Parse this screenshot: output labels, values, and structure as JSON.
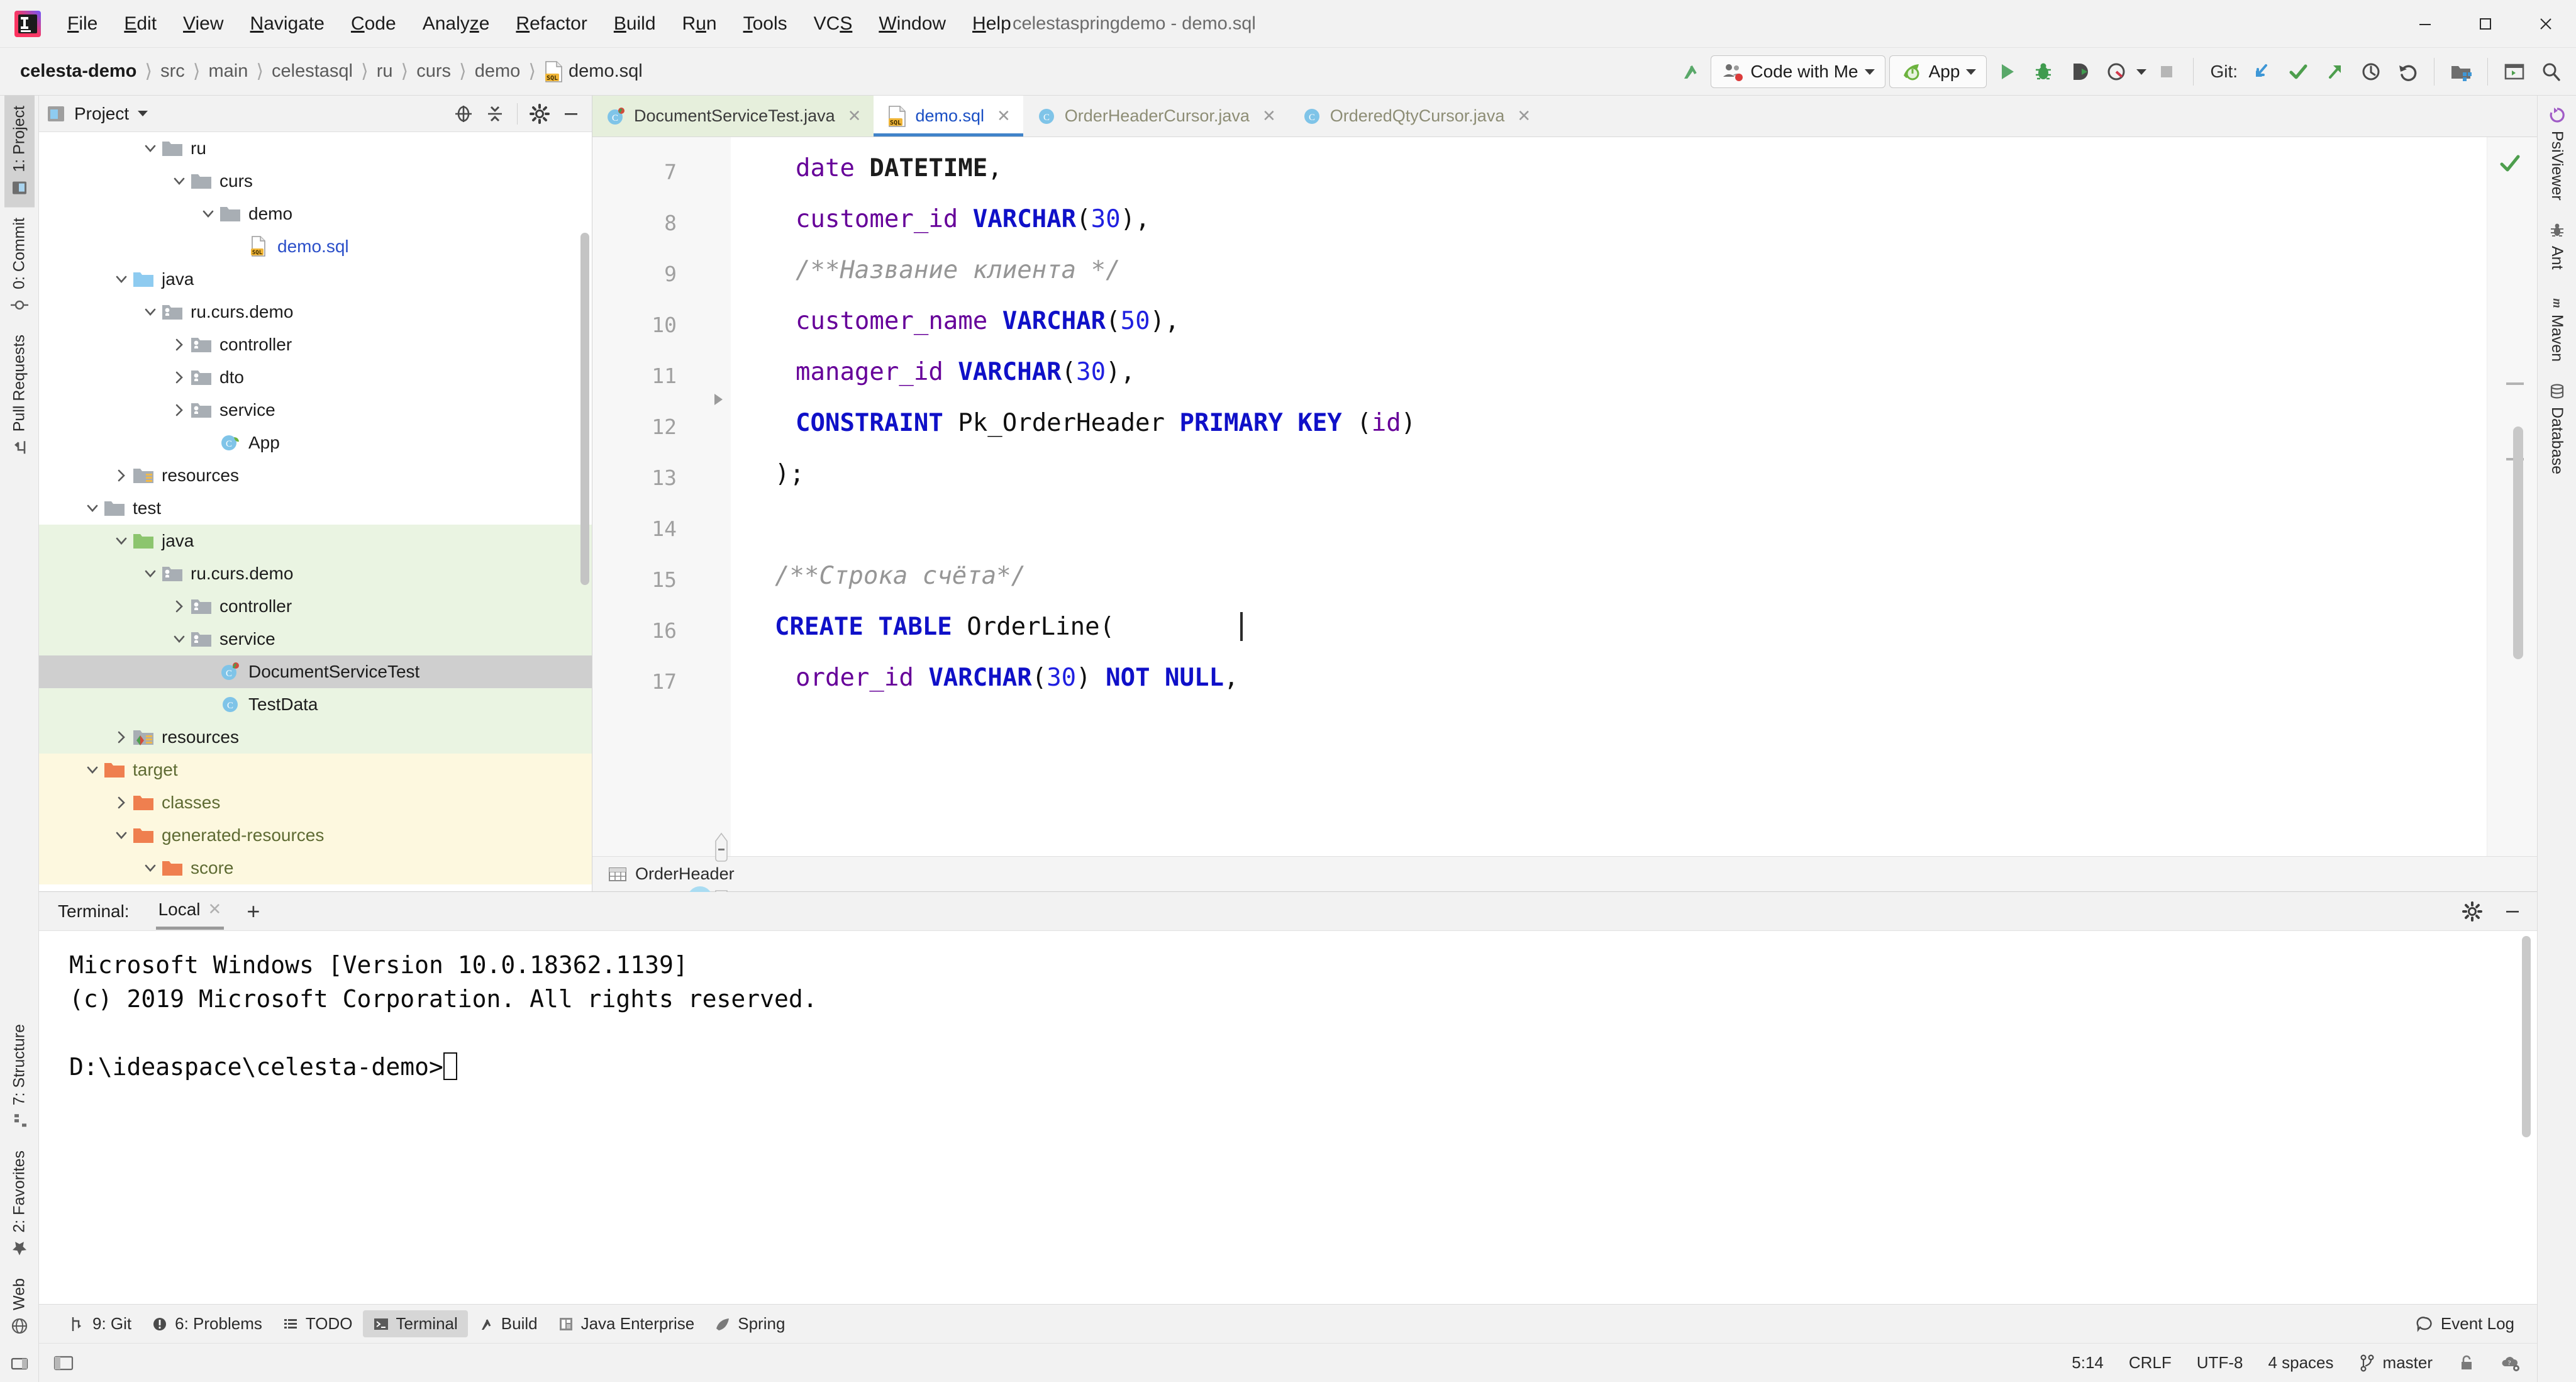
{
  "window": {
    "title": "celestaspringdemo - demo.sql",
    "controls": [
      "minimize",
      "maximize",
      "close"
    ]
  },
  "menubar": {
    "items": [
      {
        "label": "File",
        "mnemonic": "F"
      },
      {
        "label": "Edit",
        "mnemonic": "E"
      },
      {
        "label": "View",
        "mnemonic": "V"
      },
      {
        "label": "Navigate",
        "mnemonic": "N"
      },
      {
        "label": "Code",
        "mnemonic": "C"
      },
      {
        "label": "Analyze",
        "mnemonic": "z"
      },
      {
        "label": "Refactor",
        "mnemonic": "R"
      },
      {
        "label": "Build",
        "mnemonic": "B"
      },
      {
        "label": "Run",
        "mnemonic": "u"
      },
      {
        "label": "Tools",
        "mnemonic": "T"
      },
      {
        "label": "VCS",
        "mnemonic": "S"
      },
      {
        "label": "Window",
        "mnemonic": "W"
      },
      {
        "label": "Help",
        "mnemonic": "H"
      }
    ]
  },
  "breadcrumbs": {
    "items": [
      "celesta-demo",
      "src",
      "main",
      "celestasql",
      "ru",
      "curs",
      "demo",
      "demo.sql"
    ]
  },
  "toolbar": {
    "code_with_me": "Code with Me",
    "run_config": "App",
    "git_label": "Git:",
    "icons": [
      "build-icon",
      "code-with-me-icon",
      "run-config-icon",
      "run-icon",
      "debug-icon",
      "run-with-coverage-icon",
      "profile-icon",
      "stop-icon",
      "git-update-icon",
      "git-commit-icon",
      "git-push-icon",
      "git-history-icon",
      "git-rollback-icon",
      "project-structure-icon",
      "terminal-window-icon",
      "search-everywhere-icon"
    ]
  },
  "left_tool_strip": {
    "top": [
      {
        "label": "1: Project",
        "icon": "project-icon",
        "active": true
      },
      {
        "label": "0: Commit",
        "icon": "commit-icon",
        "active": false
      },
      {
        "label": "Pull Requests",
        "icon": "pull-request-icon",
        "active": false
      }
    ],
    "bottom": [
      {
        "label": "7: Structure",
        "icon": "structure-icon"
      },
      {
        "label": "2: Favorites",
        "icon": "star-icon"
      },
      {
        "label": "Web",
        "icon": "web-icon"
      }
    ]
  },
  "right_tool_strip": {
    "items": [
      {
        "label": "PsiViewer",
        "icon": "psiviewer-icon"
      },
      {
        "label": "Ant",
        "icon": "ant-icon"
      },
      {
        "label": "Maven",
        "icon": "maven-icon"
      },
      {
        "label": "Database",
        "icon": "database-icon"
      }
    ]
  },
  "project_panel": {
    "title": "Project",
    "header_icons": [
      "locate-icon",
      "collapse-all-icon",
      "gear-icon",
      "hide-icon"
    ],
    "tree": [
      {
        "label": "ru",
        "indent": 3,
        "arrow": "down",
        "icon": "folder",
        "highlight": "none"
      },
      {
        "label": "curs",
        "indent": 4,
        "arrow": "down",
        "icon": "folder",
        "highlight": "none"
      },
      {
        "label": "demo",
        "indent": 5,
        "arrow": "down",
        "icon": "folder",
        "highlight": "none"
      },
      {
        "label": "demo.sql",
        "indent": 6,
        "arrow": "none",
        "icon": "sql-file",
        "highlight": "none",
        "color": "blue"
      },
      {
        "label": "java",
        "indent": 2,
        "arrow": "down",
        "icon": "folder-source",
        "highlight": "none"
      },
      {
        "label": "ru.curs.demo",
        "indent": 3,
        "arrow": "down",
        "icon": "package",
        "highlight": "none"
      },
      {
        "label": "controller",
        "indent": 4,
        "arrow": "right",
        "icon": "package",
        "highlight": "none"
      },
      {
        "label": "dto",
        "indent": 4,
        "arrow": "right",
        "icon": "package",
        "highlight": "none"
      },
      {
        "label": "service",
        "indent": 4,
        "arrow": "right",
        "icon": "package",
        "highlight": "none"
      },
      {
        "label": "App",
        "indent": 5,
        "arrow": "none",
        "icon": "spring-class",
        "highlight": "none"
      },
      {
        "label": "resources",
        "indent": 2,
        "arrow": "right",
        "icon": "folder-res",
        "highlight": "none"
      },
      {
        "label": "test",
        "indent": 1,
        "arrow": "down",
        "icon": "folder",
        "highlight": "none"
      },
      {
        "label": "java",
        "indent": 2,
        "arrow": "down",
        "icon": "folder-test",
        "highlight": "green"
      },
      {
        "label": "ru.curs.demo",
        "indent": 3,
        "arrow": "down",
        "icon": "package",
        "highlight": "green"
      },
      {
        "label": "controller",
        "indent": 4,
        "arrow": "right",
        "icon": "package",
        "highlight": "green"
      },
      {
        "label": "service",
        "indent": 4,
        "arrow": "down",
        "icon": "package",
        "highlight": "green"
      },
      {
        "label": "DocumentServiceTest",
        "indent": 5,
        "arrow": "none",
        "icon": "test-class",
        "highlight": "grey"
      },
      {
        "label": "TestData",
        "indent": 5,
        "arrow": "none",
        "icon": "class",
        "highlight": "green"
      },
      {
        "label": "resources",
        "indent": 2,
        "arrow": "right",
        "icon": "folder-testres",
        "highlight": "green"
      },
      {
        "label": "target",
        "indent": 1,
        "arrow": "down",
        "icon": "folder-target",
        "highlight": "yellow",
        "color": "olive"
      },
      {
        "label": "classes",
        "indent": 2,
        "arrow": "right",
        "icon": "folder-target",
        "highlight": "yellow",
        "color": "olive"
      },
      {
        "label": "generated-resources",
        "indent": 2,
        "arrow": "down",
        "icon": "folder-target",
        "highlight": "yellow",
        "color": "olive"
      },
      {
        "label": "score",
        "indent": 3,
        "arrow": "down",
        "icon": "folder-target",
        "highlight": "yellow",
        "color": "olive"
      }
    ]
  },
  "editor_tabs": [
    {
      "label": "DocumentServiceTest.java",
      "icon": "test-class-icon",
      "state": "green"
    },
    {
      "label": "demo.sql",
      "icon": "sql-file-icon",
      "state": "active"
    },
    {
      "label": "OrderHeaderCursor.java",
      "icon": "class-icon",
      "state": "dim"
    },
    {
      "label": "OrderedQtyCursor.java",
      "icon": "class-icon",
      "state": "dim"
    }
  ],
  "editor": {
    "file": "demo.sql",
    "breadcrumb": "OrderHeader",
    "breadcrumb_icon": "table-icon",
    "first_visible_line": 7,
    "lines": [
      {
        "no": 7,
        "indent": 1,
        "tokens": [
          {
            "t": "date",
            "c": "idp"
          },
          {
            "t": " ",
            "c": "plain"
          },
          {
            "t": "DATETIME",
            "c": "kw2"
          },
          {
            "t": ",",
            "c": "plain"
          }
        ]
      },
      {
        "no": 8,
        "indent": 1,
        "tokens": [
          {
            "t": "customer_id",
            "c": "idp"
          },
          {
            "t": " ",
            "c": "plain"
          },
          {
            "t": "VARCHAR",
            "c": "kw"
          },
          {
            "t": "(",
            "c": "plain"
          },
          {
            "t": "30",
            "c": "num"
          },
          {
            "t": "),",
            "c": "plain"
          }
        ]
      },
      {
        "no": 9,
        "indent": 1,
        "tokens": [
          {
            "t": "/**Название клиента */",
            "c": "cmt"
          }
        ]
      },
      {
        "no": 10,
        "indent": 1,
        "tokens": [
          {
            "t": "customer_name",
            "c": "idp"
          },
          {
            "t": " ",
            "c": "plain"
          },
          {
            "t": "VARCHAR",
            "c": "kw"
          },
          {
            "t": "(",
            "c": "plain"
          },
          {
            "t": "50",
            "c": "num"
          },
          {
            "t": "),",
            "c": "plain"
          }
        ]
      },
      {
        "no": 11,
        "indent": 1,
        "tokens": [
          {
            "t": "manager_id",
            "c": "idp"
          },
          {
            "t": " ",
            "c": "plain"
          },
          {
            "t": "VARCHAR",
            "c": "kw"
          },
          {
            "t": "(",
            "c": "plain"
          },
          {
            "t": "30",
            "c": "num"
          },
          {
            "t": "),",
            "c": "plain"
          }
        ]
      },
      {
        "no": 12,
        "indent": 1,
        "tokens": [
          {
            "t": "CONSTRAINT",
            "c": "kw"
          },
          {
            "t": " Pk_OrderHeader ",
            "c": "plain"
          },
          {
            "t": "PRIMARY KEY",
            "c": "kw"
          },
          {
            "t": " (",
            "c": "plain"
          },
          {
            "t": "id",
            "c": "idp"
          },
          {
            "t": ")",
            "c": "plain"
          }
        ]
      },
      {
        "no": 13,
        "indent": 0,
        "tokens": [
          {
            "t": ");",
            "c": "plain"
          }
        ]
      },
      {
        "no": 14,
        "indent": 0,
        "tokens": []
      },
      {
        "no": 15,
        "indent": 0,
        "tokens": [
          {
            "t": "/**Строка счёта*/",
            "c": "cmt"
          }
        ]
      },
      {
        "no": 16,
        "indent": 0,
        "tokens": [
          {
            "t": "CREATE TABLE",
            "c": "kw"
          },
          {
            "t": " OrderLine(",
            "c": "plain"
          }
        ]
      },
      {
        "no": 17,
        "indent": 1,
        "tokens": [
          {
            "t": "order_id",
            "c": "idp"
          },
          {
            "t": " ",
            "c": "plain"
          },
          {
            "t": "VARCHAR",
            "c": "kw"
          },
          {
            "t": "(",
            "c": "plain"
          },
          {
            "t": "30",
            "c": "num"
          },
          {
            "t": ") ",
            "c": "plain"
          },
          {
            "t": "NOT NULL",
            "c": "kw"
          },
          {
            "t": ",",
            "c": "plain"
          }
        ]
      }
    ]
  },
  "terminal": {
    "label": "Terminal:",
    "tabs": [
      {
        "label": "Local",
        "active": true
      }
    ],
    "add_button": "+",
    "header_icons": [
      "gear-icon",
      "hide-icon"
    ],
    "lines": [
      "Microsoft Windows [Version 10.0.18362.1139]",
      "(c) 2019 Microsoft Corporation. All rights reserved.",
      "",
      "D:\\ideaspace\\celesta-demo>"
    ]
  },
  "statusbar": {
    "tools": [
      {
        "label": "9: Git",
        "icon": "git-branch-icon",
        "active": false,
        "mnemonic": "9"
      },
      {
        "label": "6: Problems",
        "icon": "problems-icon",
        "active": false,
        "mnemonic": "6"
      },
      {
        "label": "TODO",
        "icon": "todo-icon",
        "active": false
      },
      {
        "label": "Terminal",
        "icon": "terminal-icon",
        "active": true
      },
      {
        "label": "Build",
        "icon": "build-icon",
        "active": false
      },
      {
        "label": "Java Enterprise",
        "icon": "java-enterprise-icon",
        "active": false
      },
      {
        "label": "Spring",
        "icon": "spring-icon",
        "active": false
      }
    ],
    "event_log": "Event Log",
    "caret_position": "5:14",
    "line_separator": "CRLF",
    "encoding": "UTF-8",
    "indent": "4 spaces",
    "branch": "master",
    "right_icons": [
      "lock-icon",
      "settings-sync-icon"
    ]
  },
  "colors": {
    "accent_blue": "#4083c9",
    "keyword": "#0f10c8",
    "identifier": "#660099",
    "number": "#2020e0",
    "comment": "#969696",
    "test_source_bg": "#eaf4e2",
    "target_bg": "#fdf8df",
    "selection_bg": "#cfcfcf",
    "chrome_bg": "#f2f2f2"
  }
}
